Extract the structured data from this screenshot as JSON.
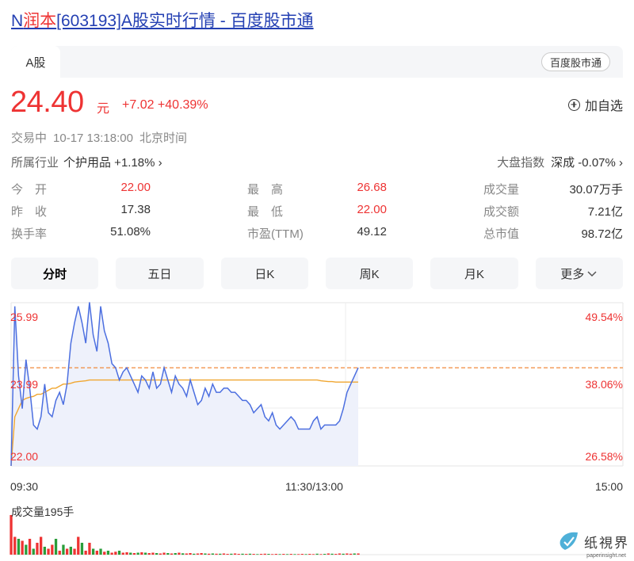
{
  "page": {
    "title_prefix": "N",
    "title_highlight": "润本",
    "title_rest": "[603193]A股实时行情 - 百度股市通"
  },
  "tab": {
    "label": "A股"
  },
  "source_badge": "百度股市通",
  "quote": {
    "price": "24.40",
    "unit": "元",
    "change": "+7.02 +40.39%",
    "add_watchlist": "加自选"
  },
  "status": {
    "state": "交易中",
    "time": "10-17 13:18:00",
    "timezone": "北京时间"
  },
  "industry": {
    "label": "所属行业",
    "value": "个护用品 +1.18% ›"
  },
  "market_index": {
    "label": "大盘指数",
    "value": "深成 -0.07% ›"
  },
  "stats": [
    [
      {
        "k": "今　开",
        "v": "22.00",
        "color": "#e33"
      },
      {
        "k": "最　高",
        "v": "26.68",
        "color": "#e33"
      },
      {
        "k": "成交量",
        "v": "30.07万手",
        "color": "#333"
      }
    ],
    [
      {
        "k": "昨　收",
        "v": "17.38",
        "color": "#333"
      },
      {
        "k": "最　低",
        "v": "22.00",
        "color": "#e33"
      },
      {
        "k": "成交额",
        "v": "7.21亿",
        "color": "#333"
      }
    ],
    [
      {
        "k": "换手率",
        "v": "51.08%",
        "color": "#333"
      },
      {
        "k": "市盈(TTM)",
        "v": "49.12",
        "color": "#333"
      },
      {
        "k": "总市值",
        "v": "98.72亿",
        "color": "#333"
      }
    ]
  ],
  "period_tabs": [
    "分时",
    "五日",
    "日K",
    "周K",
    "月K",
    "更多"
  ],
  "chart_data": {
    "type": "line",
    "y_left_ticks": [
      "25.99",
      "23.99",
      "22.00"
    ],
    "y_right_ticks": [
      "49.54%",
      "38.06%",
      "26.58%"
    ],
    "x_ticks": [
      "09:30",
      "11:30/13:00",
      "15:00"
    ],
    "prev_close": 24.4,
    "ylim": [
      22.0,
      25.99
    ],
    "series": [
      {
        "values": [
          22.0,
          25.9,
          24.2,
          23.4,
          24.6,
          23.9,
          23.0,
          22.9,
          23.2,
          24.0,
          23.3,
          23.2,
          23.6,
          23.8,
          23.5,
          24.0,
          25.0,
          25.5,
          25.9,
          25.5,
          25.0,
          26.0,
          25.2,
          24.8,
          25.9,
          25.3,
          25.0,
          24.5,
          24.4,
          24.1,
          24.3,
          24.4,
          24.2,
          24.0,
          23.8,
          24.2,
          24.1,
          23.9,
          24.3,
          23.9,
          24.0,
          24.4,
          24.1,
          23.8,
          24.2,
          24.0,
          23.9,
          23.7,
          24.1,
          23.8,
          23.5,
          23.6,
          23.9,
          23.7,
          24.0,
          23.8,
          23.8,
          23.9,
          23.9,
          23.8,
          23.8,
          23.7,
          23.6,
          23.6,
          23.5,
          23.3,
          23.4,
          23.5,
          23.2,
          23.1,
          23.3,
          23.0,
          22.9,
          23.0,
          23.1,
          23.2,
          23.1,
          22.9,
          22.9,
          22.9,
          22.9,
          23.1,
          23.2,
          22.9,
          23.0,
          23.0,
          23.0,
          23.0,
          23.1,
          23.4,
          23.8,
          24.0,
          24.2,
          24.4
        ]
      },
      {
        "values": [
          22.0,
          23.2,
          23.4,
          23.6,
          23.65,
          23.68,
          23.7,
          23.75,
          23.75,
          23.8,
          23.85,
          23.9,
          23.9,
          23.95,
          24.0,
          24.0,
          24.02,
          24.05,
          24.06,
          24.07,
          24.08,
          24.1,
          24.1,
          24.1,
          24.1,
          24.1,
          24.1,
          24.1,
          24.1,
          24.1,
          24.1,
          24.1,
          24.1,
          24.1,
          24.1,
          24.1,
          24.1,
          24.1,
          24.1,
          24.1,
          24.1,
          24.1,
          24.1,
          24.1,
          24.1,
          24.1,
          24.1,
          24.1,
          24.1,
          24.1,
          24.1,
          24.1,
          24.1,
          24.1,
          24.1,
          24.1,
          24.1,
          24.1,
          24.1,
          24.1,
          24.1,
          24.1,
          24.1,
          24.1,
          24.1,
          24.1,
          24.1,
          24.1,
          24.1,
          24.1,
          24.1,
          24.1,
          24.1,
          24.1,
          24.1,
          24.1,
          24.1,
          24.1,
          24.1,
          24.1,
          24.1,
          24.1,
          24.1,
          24.08,
          24.07,
          24.06,
          24.06,
          24.05,
          24.05,
          24.05,
          24.05,
          24.05,
          24.05,
          24.05
        ]
      }
    ],
    "volume": {
      "label": "成交量195手",
      "values": [
        2.0,
        0.9,
        0.8,
        0.7,
        0.5,
        0.8,
        0.3,
        0.6,
        0.9,
        0.4,
        0.3,
        0.5,
        0.8,
        0.2,
        0.5,
        0.3,
        0.4,
        0.3,
        0.9,
        0.6,
        0.2,
        0.6,
        0.3,
        0.2,
        0.3,
        0.15,
        0.2,
        0.1,
        0.15,
        0.2,
        0.1,
        0.12,
        0.1,
        0.08,
        0.1,
        0.12,
        0.1,
        0.08,
        0.1,
        0.08,
        0.06,
        0.1,
        0.08,
        0.06,
        0.08,
        0.1,
        0.07,
        0.06,
        0.08,
        0.05,
        0.06,
        0.08,
        0.06,
        0.05,
        0.06,
        0.05,
        0.05,
        0.06,
        0.04,
        0.05,
        0.06,
        0.04,
        0.05,
        0.04,
        0.05,
        0.04,
        0.03,
        0.04,
        0.05,
        0.04,
        0.03,
        0.04,
        0.03,
        0.04,
        0.03,
        0.04,
        0.03,
        0.03,
        0.04,
        0.03,
        0.04,
        0.03,
        0.05,
        0.03,
        0.04,
        0.06,
        0.05,
        0.04,
        0.06,
        0.05,
        0.06,
        0.05,
        0.06,
        0.06
      ],
      "colors": [
        "#e33",
        "#e33",
        "#2a9d3a",
        "#e33",
        "#2a9d3a",
        "#e33",
        "#2a9d3a",
        "#e33",
        "#e33",
        "#2a9d3a"
      ]
    }
  },
  "watermark": {
    "text": "纸視界",
    "sub": "paperinsight.net"
  }
}
